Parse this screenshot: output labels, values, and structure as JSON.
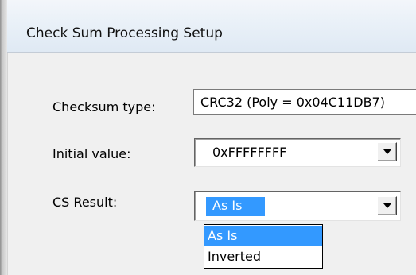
{
  "window": {
    "title": "Check Sum Processing Setup"
  },
  "form": {
    "checksum_type": {
      "label": "Checksum type:",
      "value": "CRC32 (Poly = 0x04C11DB7)"
    },
    "initial_value": {
      "label": "Initial value:",
      "value": "0xFFFFFFFF"
    },
    "cs_result": {
      "label": "CS Result:",
      "value": "As Is",
      "options": [
        "As Is",
        "Inverted"
      ],
      "highlighted_option": "As Is"
    }
  },
  "icons": {
    "dropdown_arrow": "chevron-down-icon"
  },
  "colors": {
    "selection": "#3399ff",
    "background": "#f0f0f0"
  }
}
